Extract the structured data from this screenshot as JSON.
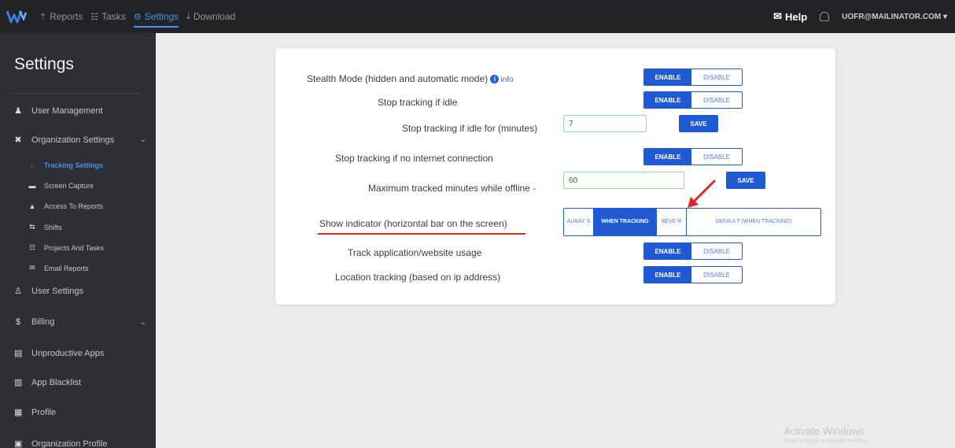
{
  "topbar": {
    "nav": [
      {
        "label": "Reports",
        "icon": "chart-icon"
      },
      {
        "label": "Tasks",
        "icon": "list-icon"
      },
      {
        "label": "Settings",
        "icon": "settings-icon",
        "active": true
      },
      {
        "label": "Download",
        "icon": "download-icon"
      }
    ],
    "help": "Help",
    "account": "UOFR@MAILINATOR.COM"
  },
  "sidebar": {
    "title": "Settings",
    "items": [
      {
        "label": "User Management",
        "icon": "users-icon"
      },
      {
        "label": "Organization Settings",
        "icon": "org-icon",
        "expandable": true
      },
      {
        "label": "Tracking Settings",
        "icon": "tracking-icon",
        "sub": true,
        "active": true
      },
      {
        "label": "Screen Capture",
        "icon": "camera-icon",
        "sub": true
      },
      {
        "label": "Access To Reports",
        "icon": "lock-icon",
        "sub": true
      },
      {
        "label": "Shifts",
        "icon": "shifts-icon",
        "sub": true
      },
      {
        "label": "Projects And Tasks",
        "icon": "projects-icon",
        "sub": true
      },
      {
        "label": "Email Reports",
        "icon": "email-icon",
        "sub": true
      },
      {
        "label": "User Settings",
        "icon": "user-settings-icon"
      },
      {
        "label": "Billing",
        "icon": "dollar-icon",
        "expandable": true
      },
      {
        "label": "Unproductive Apps",
        "icon": "apps-icon"
      },
      {
        "label": "App Blacklist",
        "icon": "blacklist-icon"
      },
      {
        "label": "Profile",
        "icon": "profile-icon"
      },
      {
        "label": "Organization Profile",
        "icon": "org-profile-icon"
      }
    ]
  },
  "settings": {
    "stealth": {
      "label": "Stealth Mode (hidden and automatic mode)",
      "info": "info",
      "enable": "ENABLE",
      "disable": "DISABLE"
    },
    "idle": {
      "label": "Stop tracking if idle",
      "enable": "ENABLE",
      "disable": "DISABLE"
    },
    "idle_minutes": {
      "label": "Stop tracking if idle for (minutes)",
      "value": "7",
      "save": "SAVE"
    },
    "no_internet": {
      "label": "Stop tracking if no internet connection",
      "enable": "ENABLE",
      "disable": "DISABLE"
    },
    "offline_max": {
      "label": "Maximum tracked minutes while offline -",
      "value": "60",
      "save": "SAVE"
    },
    "indicator": {
      "label": "Show indicator (horizontal bar on the screen)",
      "options": [
        "ALWAY S",
        "WHEN TRACKING",
        "NEVE R",
        "DEFAULT (WHEN TRACKING)"
      ],
      "selected": "WHEN TRACKING"
    },
    "app_usage": {
      "label": "Track application/website usage",
      "enable": "ENABLE",
      "disable": "DISABLE"
    },
    "location": {
      "label": "Location tracking (based on ip address)",
      "enable": "ENABLE",
      "disable": "DISABLE"
    }
  },
  "watermark": {
    "title": "Activate Windows",
    "subtitle": "Go to Settings to activate Windows."
  },
  "colors": {
    "accent": "#1f5ad3",
    "annotation": "#d92a2a",
    "sidebar": "#2d2f34",
    "topbar": "#222327"
  }
}
